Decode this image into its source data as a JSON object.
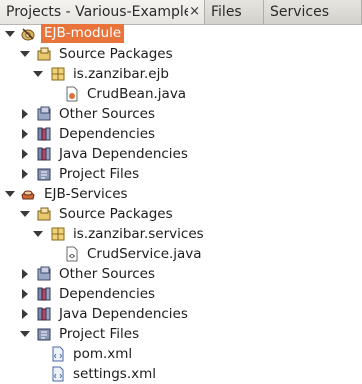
{
  "tabs": [
    {
      "label": "Projects - Various-Examples",
      "close_label": "×"
    },
    {
      "label": "Files"
    },
    {
      "label": "Services"
    }
  ],
  "tree": {
    "ejb_module": {
      "label": "EJB-module",
      "source_packages": {
        "label": "Source Packages",
        "package": {
          "label": "is.zanzibar.ejb",
          "file": "CrudBean.java"
        }
      },
      "other_sources": "Other Sources",
      "dependencies": "Dependencies",
      "java_dependencies": "Java Dependencies",
      "project_files": "Project Files"
    },
    "ejb_services": {
      "label": "EJB-Services",
      "source_packages": {
        "label": "Source Packages",
        "package": {
          "label": "is.zanzibar.services",
          "file": "CrudService.java"
        }
      },
      "other_sources": "Other Sources",
      "dependencies": "Dependencies",
      "java_dependencies": "Java Dependencies",
      "project_files": {
        "label": "Project Files",
        "files": [
          "pom.xml",
          "settings.xml"
        ]
      }
    }
  },
  "colors": {
    "selection": "#e8743b"
  }
}
